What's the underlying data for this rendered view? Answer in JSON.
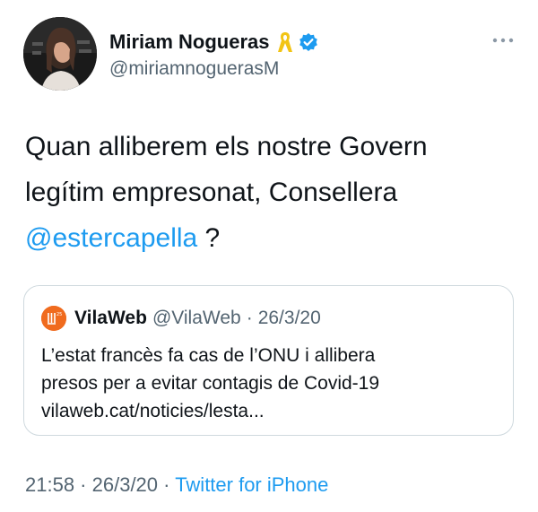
{
  "tweet": {
    "author": {
      "display_name": "Miriam Nogueras",
      "handle": "@miriamnoguerasM",
      "avatar_icon": "profile-photo",
      "badges": [
        "yellow-ribbon-icon",
        "verified-badge-icon"
      ]
    },
    "more_icon": "ellipsis-icon",
    "text_before_mention": "Quan alliberem els nostre Govern legítim empresonat, Consellera ",
    "mention": "@estercapella",
    "text_after_mention": " ?",
    "quote": {
      "avatar_icon": "vilaweb-logo",
      "name": "VilaWeb",
      "handle": "@VilaWeb",
      "separator": "·",
      "date": "26/3/20",
      "text_line1": "L’estat francès fa cas de l’ONU i allibera",
      "text_line2": "presos per a evitar contagis de Covid-19",
      "text_line3": "vilaweb.cat/noticies/lesta..."
    },
    "meta": {
      "time": "21:58",
      "separator1": " · ",
      "date": "26/3/20",
      "separator2": " · ",
      "source": "Twitter for iPhone"
    }
  },
  "colors": {
    "link": "#1d9bf0",
    "secondary_text": "#536471",
    "primary_text": "#0f1419",
    "border": "#cfd9de",
    "vilaweb_orange": "#f06b1e",
    "ribbon_yellow": "#f2c414"
  }
}
